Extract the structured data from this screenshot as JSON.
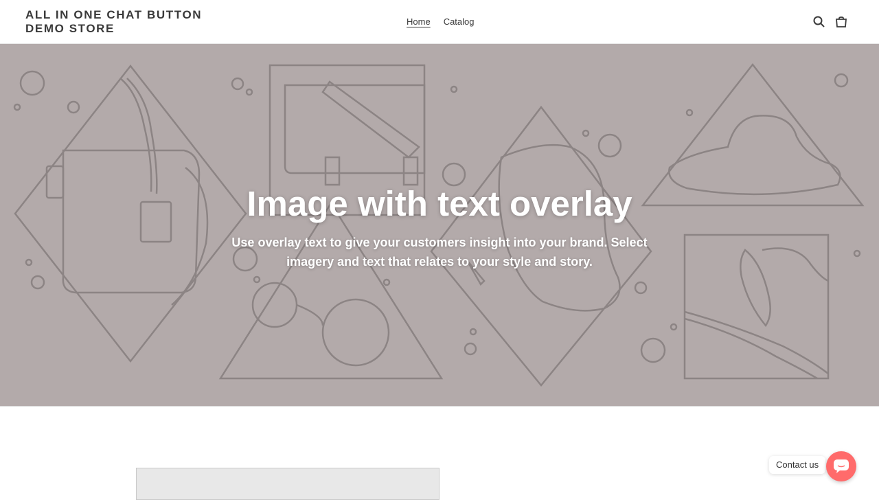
{
  "store": {
    "title": "ALL IN ONE CHAT BUTTON DEMO STORE"
  },
  "nav": {
    "items": [
      {
        "label": "Home",
        "active": true
      },
      {
        "label": "Catalog",
        "active": false
      }
    ]
  },
  "header_icons": [
    "search-icon",
    "cart-icon"
  ],
  "hero": {
    "title": "Image with text overlay",
    "subtitle": "Use overlay text to give your customers insight into your brand. Select imagery and text that relates to your style and story.",
    "background_color": "#b3aaaa",
    "line_color": "#8c8484"
  },
  "contact": {
    "label": "Contact us",
    "button_color": "#ff6b6b",
    "icon": "chat-bubble-icon"
  }
}
